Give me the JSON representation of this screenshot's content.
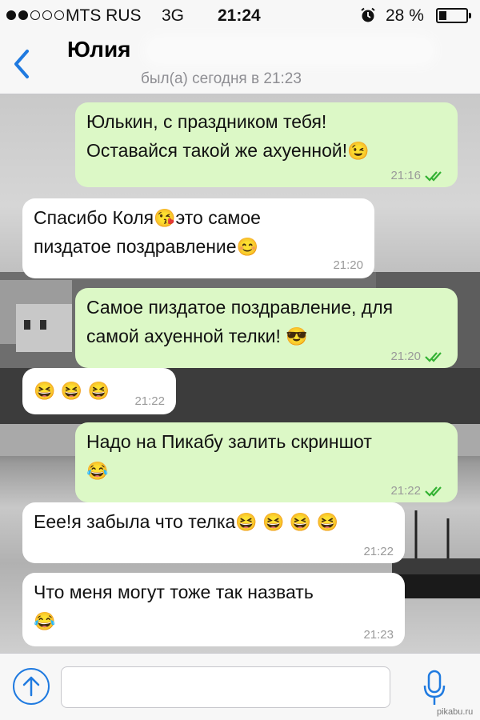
{
  "status_bar": {
    "carrier": "MTS RUS",
    "network": "3G",
    "time": "21:24",
    "battery_text": "28 %",
    "battery_level": 0.28,
    "signal_bars_filled": 2,
    "signal_bars_total": 5,
    "icons": [
      "alarm-clock-icon",
      "battery-icon"
    ]
  },
  "header": {
    "back_icon": "chevron-left-icon",
    "contact_name": "Юлия",
    "last_seen": "был(а) сегодня в 21:23"
  },
  "messages": [
    {
      "direction": "outgoing",
      "lines": [
        "Юлькин, с праздником тебя!",
        "Оставайся такой же ахуенной!"
      ],
      "emoji": [
        "😉"
      ],
      "time": "21:16",
      "read": true
    },
    {
      "direction": "incoming",
      "lines": [
        "Спасибо Коля",
        "это самое",
        "пиздатое поздравление"
      ],
      "emoji": [
        "😘",
        "😊"
      ],
      "time": "21:20"
    },
    {
      "direction": "outgoing",
      "lines": [
        "Самое пиздатое поздравление, для",
        "самой ахуенной телки!"
      ],
      "emoji": [
        "😎"
      ],
      "time": "21:20",
      "read": true
    },
    {
      "direction": "incoming",
      "lines": [],
      "emoji": [
        "😆",
        "😆",
        "😆"
      ],
      "time": "21:22"
    },
    {
      "direction": "outgoing",
      "lines": [
        "Надо на Пикабу залить скриншот"
      ],
      "emoji": [
        "😂"
      ],
      "time": "21:22",
      "read": true
    },
    {
      "direction": "incoming",
      "lines": [
        "Еее!я забыла что  телка"
      ],
      "emoji": [
        "😆",
        "😆",
        "😆",
        "😆"
      ],
      "time": "21:22"
    },
    {
      "direction": "incoming",
      "lines": [
        "Что меня могут тоже так назвать"
      ],
      "emoji": [
        "😂"
      ],
      "time": "21:23"
    }
  ],
  "input_bar": {
    "upload_icon": "arrow-up-circle-icon",
    "message_value": "",
    "mic_icon": "microphone-icon"
  },
  "watermark": "pikabu.ru",
  "colors": {
    "accent": "#1f7ae0",
    "outgoing_bubble": "#dcf8c6",
    "incoming_bubble": "#ffffff",
    "read_ticks": "#34b233"
  }
}
